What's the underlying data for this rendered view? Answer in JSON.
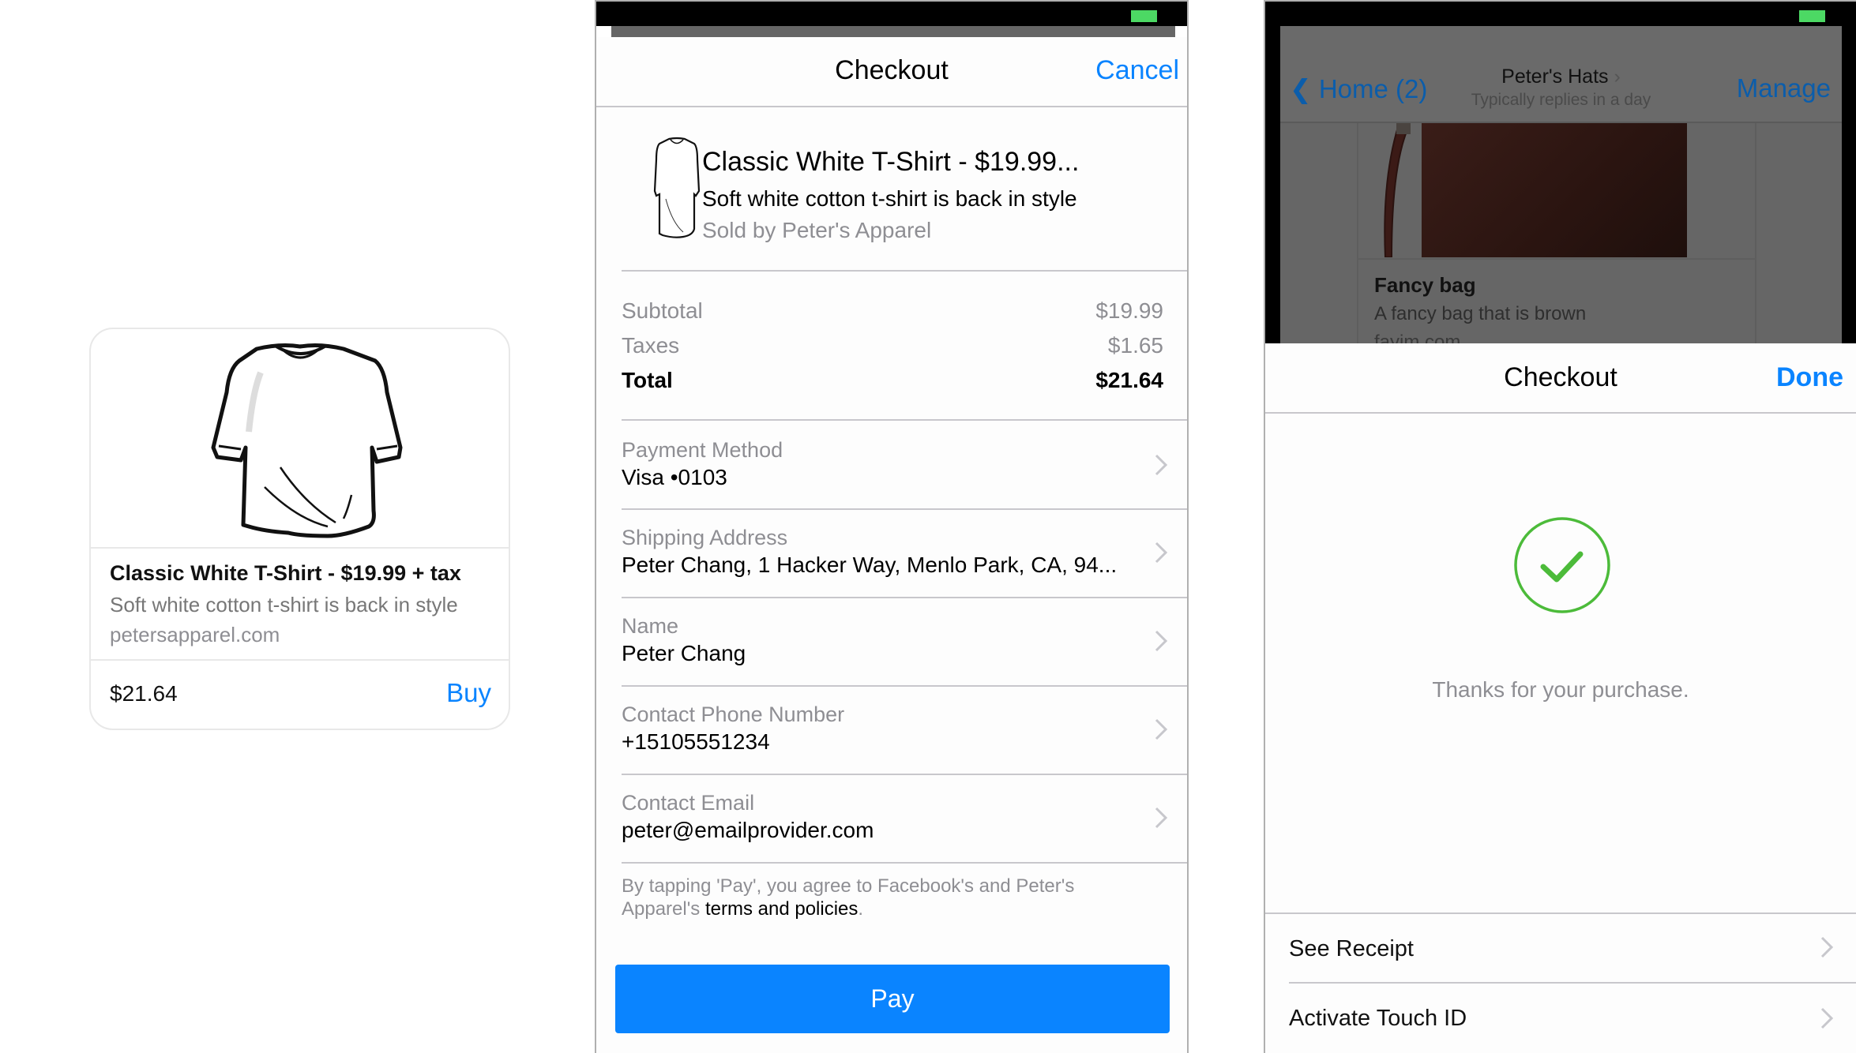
{
  "card": {
    "title": "Classic White T-Shirt - $19.99 + tax",
    "description": "Soft white cotton t-shirt is back in style",
    "url": "petersapparel.com",
    "price": "$21.64",
    "buy_label": "Buy",
    "image_icon": "tshirt-icon"
  },
  "checkout": {
    "title": "Checkout",
    "cancel_label": "Cancel",
    "product": {
      "title": "Classic White T-Shirt - $19.99...",
      "description": "Soft white cotton t-shirt is back in style",
      "seller": "Sold by Peter's Apparel"
    },
    "summary": [
      {
        "label": "Subtotal",
        "value": "$19.99"
      },
      {
        "label": "Taxes",
        "value": "$1.65"
      },
      {
        "label": "Total",
        "value": "$21.64"
      }
    ],
    "fields": [
      {
        "label": "Payment Method",
        "value": "Visa •0103"
      },
      {
        "label": "Shipping Address",
        "value": "Peter Chang, 1 Hacker Way, Menlo Park, CA, 94..."
      },
      {
        "label": "Name",
        "value": "Peter Chang"
      },
      {
        "label": "Contact Phone Number",
        "value": "+15105551234"
      },
      {
        "label": "Contact Email",
        "value": "peter@emailprovider.com"
      }
    ],
    "terms_prefix": "By tapping 'Pay', you agree to Facebook's and Peter's Apparel's ",
    "terms_link": "terms and policies",
    "terms_suffix": ".",
    "pay_label": "Pay"
  },
  "confirmation": {
    "background": {
      "back_label": "Home (2)",
      "page_title": "Peter's Hats",
      "page_subtitle": "Typically replies in a day",
      "manage_label": "Manage",
      "item_title": "Fancy bag",
      "item_description": "A fancy bag that is brown",
      "item_url": "fayim.com"
    },
    "title": "Checkout",
    "done_label": "Done",
    "message": "Thanks for your purchase.",
    "actions": [
      {
        "label": "See Receipt"
      },
      {
        "label": "Activate Touch ID"
      }
    ]
  },
  "colors": {
    "accent": "#0a84ff",
    "success": "#4cbb3a",
    "battery": "#4cd964"
  }
}
